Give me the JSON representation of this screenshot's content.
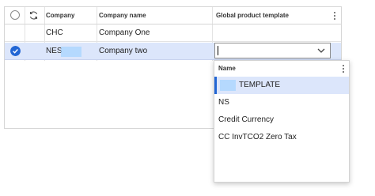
{
  "grid": {
    "columns": [
      "Company",
      "Company name",
      "Global product template"
    ],
    "rows": [
      {
        "company": "CHC",
        "company_name": "Company One",
        "global_product_template": "",
        "selected": false
      },
      {
        "company": "NES",
        "company_name": "Company two",
        "global_product_template": "",
        "selected": true
      }
    ]
  },
  "dropdown": {
    "column_header": "Name",
    "options": [
      "TEMPLATE",
      "NS",
      "Credit Currency",
      "CC InvTCO2 Zero Tax"
    ],
    "highlighted_index": 0
  },
  "icons": {
    "select_all": "circle-icon",
    "refresh": "refresh-icon",
    "row_selected": "check-circle-icon",
    "column_options": "more-vertical-icon",
    "dropdown_toggle": "chevron-down-icon"
  },
  "colors": {
    "accent": "#2266d4",
    "selected_row": "#dce6fb",
    "redaction": "#a8d4ff"
  }
}
